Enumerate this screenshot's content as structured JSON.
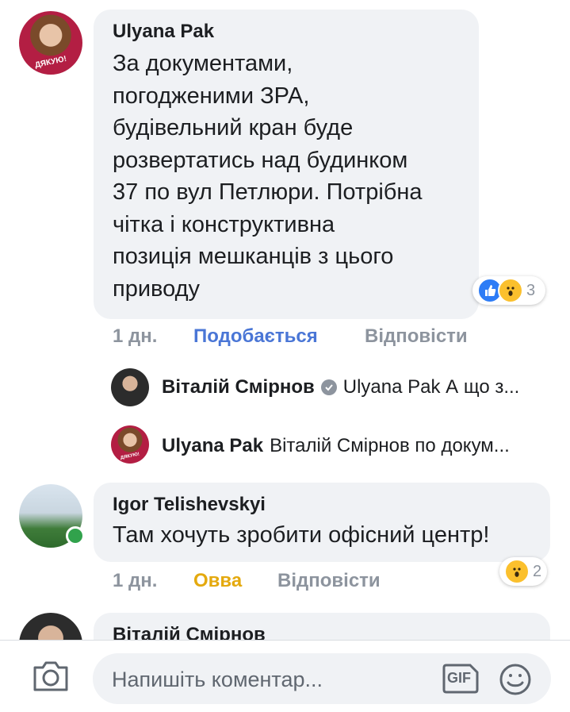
{
  "comments": [
    {
      "author": "Ulyana Pak",
      "avatar_badge": "ДЯКУЮ!",
      "text": "За документами,\nпогодженими ЗРА,\nбудівельний кран буде\nрозвертатись над будинком\n37 по вул Петлюри. Потрібна\nчітка і конструктивна\nпозиція мешканців з цього\nприводу",
      "time": "1 дн.",
      "reaction_action": "Подобається",
      "reply_action": "Відповісти",
      "reaction_count": "3"
    },
    {
      "author": "Igor Telishevskyi",
      "text": "Там хочуть зробити офісний центр!",
      "time": "1 дн.",
      "reaction_action": "Овва",
      "reply_action": "Відповісти",
      "reaction_count": "2"
    },
    {
      "author": "Віталій Смірнов"
    }
  ],
  "replies": [
    {
      "author": "Віталій Смірнов",
      "snippet": "Ulyana Pak А що з..."
    },
    {
      "author": "Ulyana Pak",
      "snippet": "Віталій Смірнов  по докум..."
    }
  ],
  "composer": {
    "placeholder": "Напишіть коментар...",
    "gif_label": "GIF"
  },
  "colors": {
    "bubble": "#f0f2f5",
    "like_blue": "#4a76d6",
    "wow_yellow": "#e4a90e",
    "meta_gray": "#8d949e"
  }
}
